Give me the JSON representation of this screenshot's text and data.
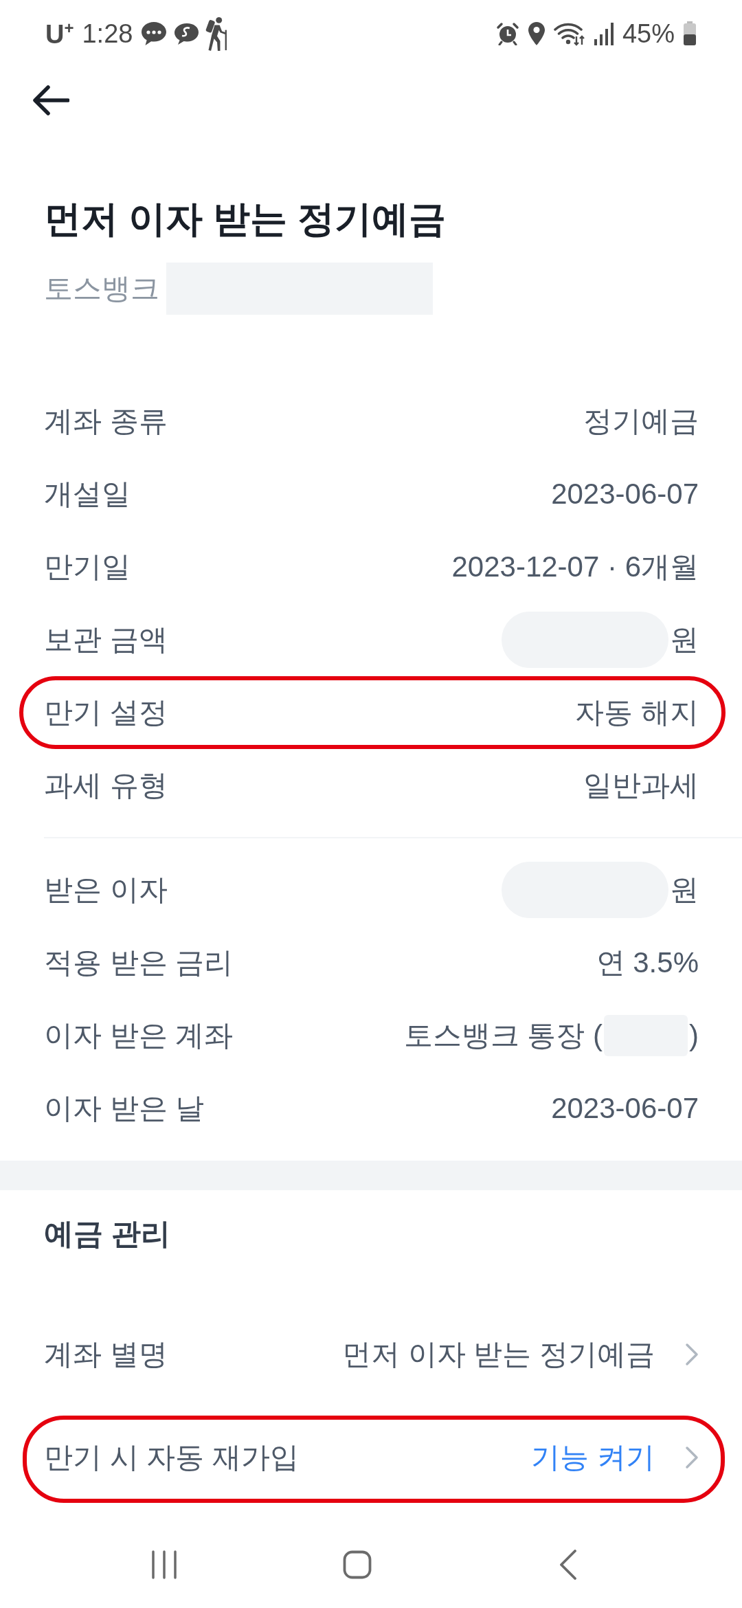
{
  "status_bar": {
    "carrier": "U$^{+}$",
    "time": "1:28",
    "battery": "45%"
  },
  "header": {
    "title": "먼저 이자 받는 정기예금",
    "subtitle": {
      "text": "토스뱅크",
      "redacted": true
    }
  },
  "detail_groups": [
    {
      "rows": [
        {
          "kind": "text",
          "label": "계좌 종류",
          "value": "정기예금",
          "highlighted": false
        },
        {
          "kind": "text",
          "label": "개설일",
          "value": "2023-06-07",
          "highlighted": false
        },
        {
          "kind": "text",
          "label": "만기일",
          "value": "2023-12-07 · 6개월",
          "highlighted": false
        },
        {
          "kind": "redacted_amount",
          "label": "보관 금액",
          "unit": "원",
          "highlighted": false
        },
        {
          "kind": "text",
          "label": "만기 설정",
          "value": "자동 해지",
          "highlighted": true
        },
        {
          "kind": "text",
          "label": "과세 유형",
          "value": "일반과세",
          "highlighted": false
        }
      ]
    },
    {
      "rows": [
        {
          "kind": "redacted_amount",
          "label": "받은 이자",
          "unit": "원",
          "highlighted": false
        },
        {
          "kind": "text",
          "label": "적용 받은 금리",
          "value": "연 3.5%",
          "highlighted": false
        },
        {
          "kind": "redacted_account",
          "label": "이자 받은 계좌",
          "prefix": "토스뱅크 통장 (",
          "suffix": ")",
          "highlighted": false
        },
        {
          "kind": "text",
          "label": "이자 받은 날",
          "value": "2023-06-07",
          "highlighted": false
        }
      ]
    }
  ],
  "management": {
    "heading": "예금 관리",
    "items": [
      {
        "kind": "value",
        "label": "계좌 별명",
        "value": "먼저 이자 받는 정기예금",
        "highlighted": false
      },
      {
        "kind": "action",
        "label": "만기 시 자동 재가입",
        "value": "기능 켜기",
        "highlighted": true
      }
    ]
  }
}
